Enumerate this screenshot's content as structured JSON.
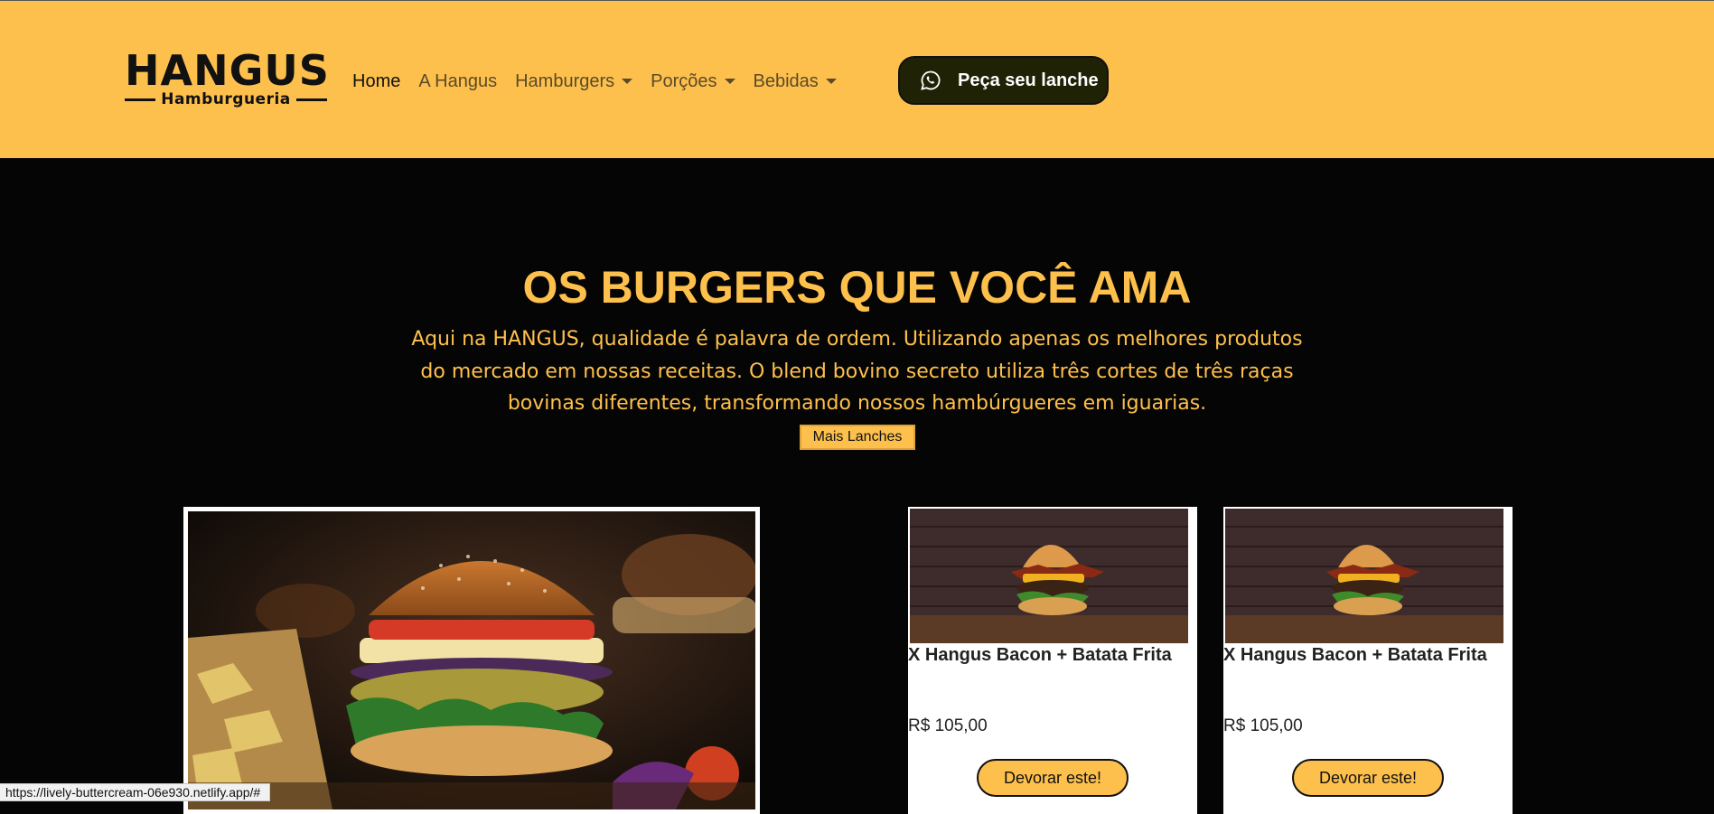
{
  "brand": {
    "name": "HANGUS",
    "subtitle": "Hamburgueria"
  },
  "nav": {
    "items": [
      {
        "label": "Home",
        "dropdown": false,
        "active": true
      },
      {
        "label": "A Hangus",
        "dropdown": false,
        "active": false
      },
      {
        "label": "Hamburgers",
        "dropdown": true,
        "active": false
      },
      {
        "label": "Porções",
        "dropdown": true,
        "active": false
      },
      {
        "label": "Bebidas",
        "dropdown": true,
        "active": false
      }
    ],
    "cta": {
      "label": "Peça seu lanche",
      "icon": "whatsapp-icon"
    }
  },
  "hero": {
    "title": "OS BURGERS QUE VOCÊ AMA",
    "description": "Aqui na HANGUS, qualidade é palavra de ordem. Utilizando apenas os melhores produtos do mercado em nossas receitas. O blend bovino secreto utiliza três cortes de três raças bovinas diferentes, transformando nossos hambúrgueres em iguarias.",
    "button_label": "Mais Lanches"
  },
  "products": [
    {
      "title": "X Hangus Bacon + Batata Frita",
      "price": "R$ 105,00",
      "button": "Devorar este!"
    },
    {
      "title": "X Hangus Bacon + Batata Frita",
      "price": "R$ 105,00",
      "button": "Devorar este!"
    }
  ],
  "status_bar": {
    "url": "https://lively-buttercream-06e930.netlify.app/#"
  },
  "colors": {
    "accent": "#fec04c",
    "background": "#050505",
    "cta_bg": "#1f2205"
  }
}
